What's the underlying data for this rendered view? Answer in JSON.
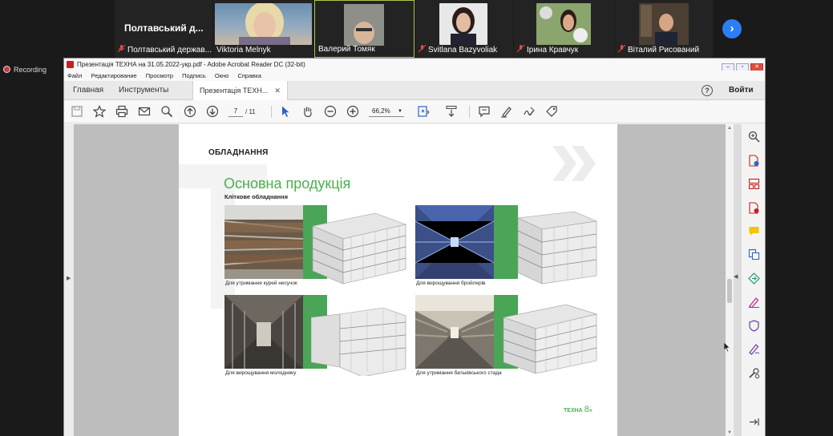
{
  "meeting": {
    "participants": [
      {
        "name": "Полтавський держав...",
        "big_label": "Полтавський  д..."
      },
      {
        "name": "Viktoria Melnyk"
      },
      {
        "name": "Валерий Томяк"
      },
      {
        "name": "Svitlana Bazyvoliak"
      },
      {
        "name": "Ірина Кравчук"
      },
      {
        "name": "Віталий Рисований"
      }
    ],
    "recording_label": "Recording"
  },
  "window": {
    "title": "Презентація ТЕХНА на 31.05.2022-укр.pdf - Adobe Acrobat Reader DC (32-bit)",
    "menu": [
      "Файл",
      "Редактирование",
      "Просмотр",
      "Подпись",
      "Окно",
      "Справка"
    ],
    "tabs": {
      "home": "Главная",
      "tools": "Инструменты",
      "document": "Презентація ТЕХН..."
    },
    "sign_in": "Войти",
    "help": "?"
  },
  "toolbar": {
    "current_page": "7",
    "total_pages": "/ 11",
    "zoom": "66,2%"
  },
  "document_page": {
    "section_header": "ОБЛАДНАННЯ",
    "title": "Основна продукція",
    "subtitle": "Кліткове обладнання",
    "items": [
      {
        "caption": "Для утримання курей несучок"
      },
      {
        "caption": "Для вирощування бройлерів"
      },
      {
        "caption": "Для вирощування молодняку"
      },
      {
        "caption": "Для утримання батьківського стада"
      }
    ],
    "footer_brand": "ТЕХНА",
    "footer_page": "8",
    "footer_arrow": "»"
  },
  "colors": {
    "accent_green": "#4caf50",
    "zoom_blue": "#2d7df6",
    "acrobat_red": "#c8201f",
    "panel_icon_purple": "#6b3fa0"
  }
}
